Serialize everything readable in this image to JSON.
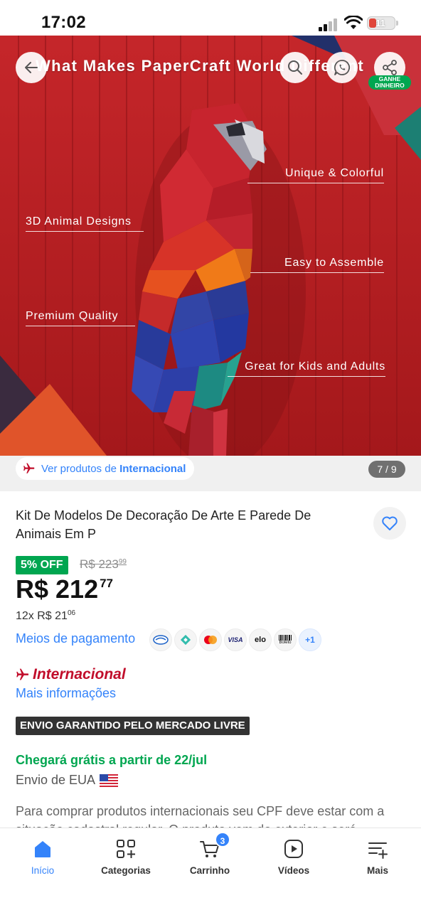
{
  "status_bar": {
    "time": "17:02",
    "battery": "11"
  },
  "hero": {
    "headline": "What Makes PaperCraft World Different",
    "features": [
      "Unique & Colorful",
      "3D Animal Designs",
      "Easy to Assemble",
      "Premium Quality",
      "Great for Kids and Adults"
    ],
    "earn_badge": "GANHE DINHEIRO"
  },
  "gallery": {
    "intl_prefix": "Ver produtos de ",
    "intl_bold": "Internacional",
    "counter": "7 / 9"
  },
  "product": {
    "title": "Kit De Modelos De Decoração De Arte E Parede De Animais Em P",
    "discount": "5% OFF",
    "old_price_int": "R$ 223",
    "old_price_cents": "99",
    "price_int": "R$ 212",
    "price_cents": "77",
    "installments_prefix": "12x R$ 21",
    "installments_cents": "06",
    "payment_link": "Meios de pagamento",
    "payment_icons": [
      "mercadopago-icon",
      "pix-icon",
      "mastercard-icon",
      "visa-icon",
      "elo-icon",
      "boleto-icon"
    ],
    "payment_labels": {
      "visa": "VISA",
      "elo": "elo",
      "boleto": "Boleto",
      "more": "+1"
    },
    "international_label": "Internacional",
    "more_info": "Mais informações",
    "guarantee": "ENVIO GARANTIDO PELO MERCADO LIVRE",
    "arrival": "Chegará grátis a partir de 22/jul",
    "ship_from": "Envio de EUA",
    "notice": "Para comprar produtos internacionais seu CPF deve estar com a situação cadastral regular. O produto vem do exterior e será"
  },
  "nav": {
    "items": [
      {
        "label": "Início",
        "icon": "home-icon"
      },
      {
        "label": "Categorias",
        "icon": "categories-icon"
      },
      {
        "label": "Carrinho",
        "icon": "cart-icon",
        "badge": "3"
      },
      {
        "label": "Vídeos",
        "icon": "play-icon"
      },
      {
        "label": "Mais",
        "icon": "menu-plus-icon"
      }
    ]
  },
  "colors": {
    "accent": "#3483fa",
    "green": "#00a650",
    "intl_red": "#c10e2b",
    "hero_red": "#b8201f"
  }
}
